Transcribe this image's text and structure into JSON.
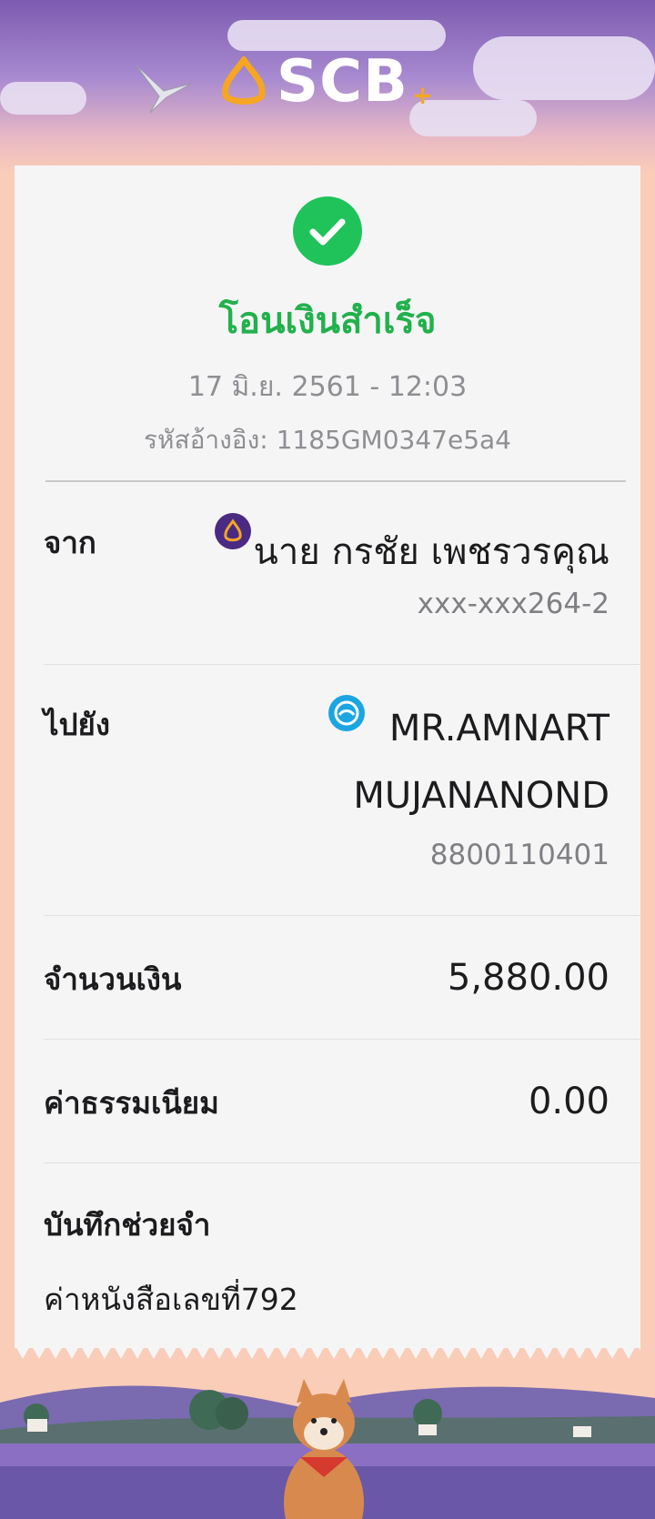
{
  "brand": {
    "name": "SCB",
    "accent": "#f5a623"
  },
  "status": {
    "title": "โอนเงินสำเร็จ",
    "color": "#22b14c"
  },
  "datetime": "17 มิ.ย. 2561 - 12:03",
  "reference": "รหัสอ้างอิง: 1185GM0347e5a4",
  "from": {
    "label": "จาก",
    "name": "นาย กรชัย เพชรวรคุณ",
    "account": "xxx-xxx264-2",
    "bank_icon": "scb-bank-icon"
  },
  "to": {
    "label": "ไปยัง",
    "name_line1": "MR.AMNART",
    "name_line2": "MUJANANOND",
    "account": "8800110401",
    "bank_icon": "krungthai-bank-icon"
  },
  "amount": {
    "label": "จำนวนเงิน",
    "value": "5,880.00"
  },
  "fee": {
    "label": "ค่าธรรมเนียม",
    "value": "0.00"
  },
  "memo": {
    "label": "บันทึกช่วยจำ",
    "value": "ค่าหนังสือเลขที่792"
  }
}
